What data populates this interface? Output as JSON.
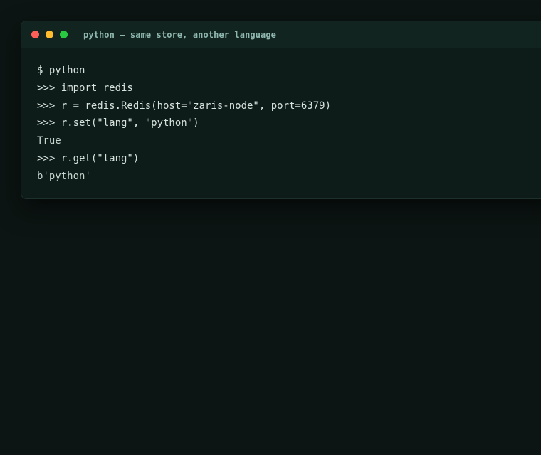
{
  "window": {
    "title": "python — same store, another language"
  },
  "terminal": {
    "lines": [
      {
        "text": "$ python",
        "kind": "shell-prompt"
      },
      {
        "text": ">>> import redis",
        "kind": "repl-input"
      },
      {
        "text": ">>> r = redis.Redis(host=\"zaris-node\", port=6379)",
        "kind": "repl-input"
      },
      {
        "text": ">>> r.set(\"lang\", \"python\")",
        "kind": "repl-input"
      },
      {
        "text": "True",
        "kind": "output"
      },
      {
        "text": ">>> r.get(\"lang\")",
        "kind": "repl-input"
      },
      {
        "text": "b'python'",
        "kind": "output"
      }
    ]
  },
  "colors": {
    "background": "#0c1513",
    "window": "#0e1c19",
    "title_bar": "#112420",
    "title_text": "#8fb7ae",
    "text": "#d6e2dd",
    "close": "#ff5f57",
    "minimize": "#febc2e",
    "maximize": "#28c840"
  }
}
